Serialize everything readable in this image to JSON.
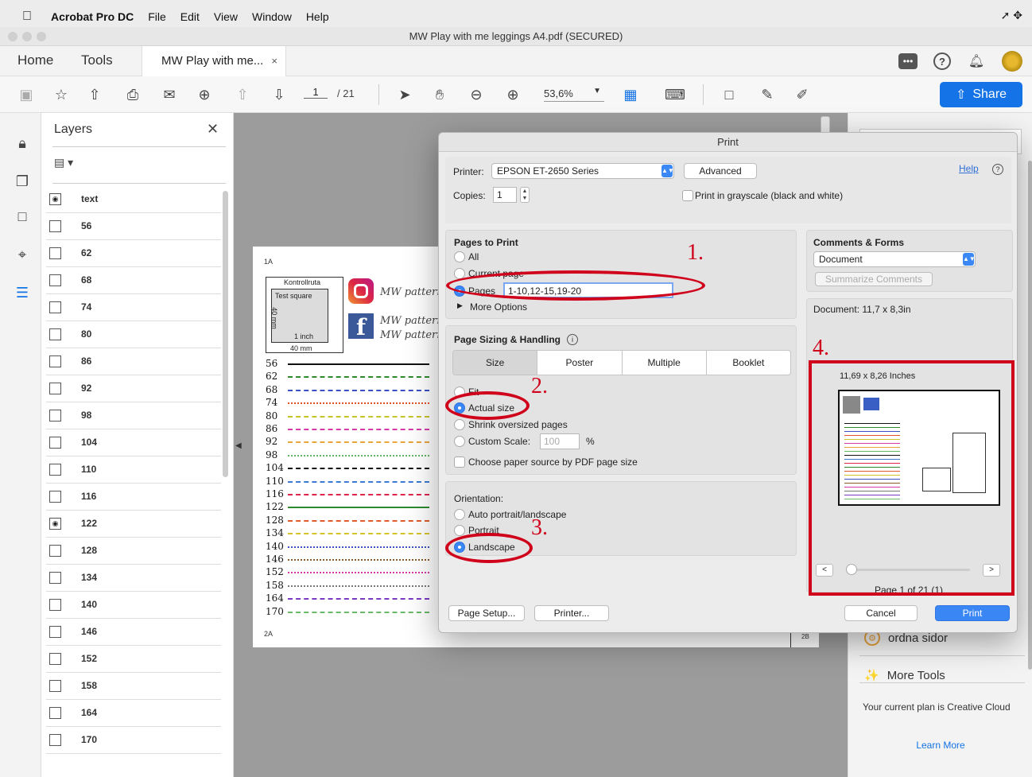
{
  "menubar": {
    "app": "Acrobat Pro DC",
    "items": [
      "File",
      "Edit",
      "View",
      "Window",
      "Help"
    ]
  },
  "window": {
    "title": "MW Play with me leggings A4.pdf (SECURED)"
  },
  "tabs": {
    "home": "Home",
    "tools": "Tools",
    "document": "MW Play with me...",
    "close": "×"
  },
  "toolbar": {
    "page_current": "1",
    "page_total": "/ 21",
    "zoom": "53,6%",
    "share": "Share"
  },
  "layers_panel": {
    "title": "Layers",
    "items": [
      {
        "name": "text",
        "visible": true
      },
      {
        "name": "56",
        "visible": false
      },
      {
        "name": "62",
        "visible": false
      },
      {
        "name": "68",
        "visible": false
      },
      {
        "name": "74",
        "visible": false
      },
      {
        "name": "80",
        "visible": false
      },
      {
        "name": "86",
        "visible": false
      },
      {
        "name": "92",
        "visible": false
      },
      {
        "name": "98",
        "visible": false
      },
      {
        "name": "104",
        "visible": false
      },
      {
        "name": "110",
        "visible": false
      },
      {
        "name": "116",
        "visible": false
      },
      {
        "name": "122",
        "visible": true
      },
      {
        "name": "128",
        "visible": false
      },
      {
        "name": "134",
        "visible": false
      },
      {
        "name": "140",
        "visible": false
      },
      {
        "name": "146",
        "visible": false
      },
      {
        "name": "152",
        "visible": false
      },
      {
        "name": "158",
        "visible": false
      },
      {
        "name": "164",
        "visible": false
      },
      {
        "name": "170",
        "visible": false
      }
    ]
  },
  "document": {
    "page_mark_top": "1A",
    "page_mark_bottom": "2A",
    "page_mark_right": "2B",
    "kontrollruta": "Kontrollruta",
    "test_square": "Test square",
    "one_inch_v": "1 inch",
    "mm_v": "40 mm",
    "one_inch_h": "1 inch",
    "mm_h": "40 mm",
    "brand_1": "MW patterns",
    "brand_2": "MW patterns",
    "brand_3": "MW patterns",
    "size_lines": [
      {
        "size": "56",
        "color": "#111111",
        "style": "solid"
      },
      {
        "size": "62",
        "color": "#2d8a2d",
        "style": "dashed"
      },
      {
        "size": "68",
        "color": "#3b4fc4",
        "style": "dashed"
      },
      {
        "size": "74",
        "color": "#e0532a",
        "style": "dotted"
      },
      {
        "size": "80",
        "color": "#c7c42a",
        "style": "dashed"
      },
      {
        "size": "86",
        "color": "#d63aa8",
        "style": "dashed"
      },
      {
        "size": "92",
        "color": "#e8a53a",
        "style": "dashed"
      },
      {
        "size": "98",
        "color": "#5fb85f",
        "style": "dotted"
      },
      {
        "size": "104",
        "color": "#111111",
        "style": "dashed"
      },
      {
        "size": "110",
        "color": "#3b7bd4",
        "style": "dashed"
      },
      {
        "size": "116",
        "color": "#e0254a",
        "style": "dashed"
      },
      {
        "size": "122",
        "color": "#2d8a2d",
        "style": "solid"
      },
      {
        "size": "128",
        "color": "#e05a2a",
        "style": "dashed"
      },
      {
        "size": "134",
        "color": "#d4c42a",
        "style": "dashed"
      },
      {
        "size": "140",
        "color": "#3b4fc4",
        "style": "dotted"
      },
      {
        "size": "146",
        "color": "#8a5a2a",
        "style": "dotted"
      },
      {
        "size": "152",
        "color": "#d63aa8",
        "style": "dotted"
      },
      {
        "size": "158",
        "color": "#777777",
        "style": "dotted"
      },
      {
        "size": "164",
        "color": "#7a3ac4",
        "style": "dashed"
      },
      {
        "size": "170",
        "color": "#6ab86a",
        "style": "dashed"
      }
    ]
  },
  "right_panel": {
    "organize": "ordna sidor",
    "more_tools": "More Tools",
    "plan": "Your current plan is Creative Cloud",
    "learn_more": "Learn More"
  },
  "print_dialog": {
    "title": "Print",
    "printer_label": "Printer:",
    "printer_value": "EPSON ET-2650 Series",
    "advanced": "Advanced",
    "help": "Help",
    "copies_label": "Copies:",
    "copies_value": "1",
    "grayscale": "Print in grayscale (black and white)",
    "pages_to_print": {
      "heading": "Pages to Print",
      "all": "All",
      "current": "Current page",
      "pages": "Pages",
      "pages_value": "1-10,12-15,19-20",
      "more_options": "More Options"
    },
    "sizing": {
      "heading": "Page Sizing & Handling",
      "tabs": [
        "Size",
        "Poster",
        "Multiple",
        "Booklet"
      ],
      "fit": "Fit",
      "actual": "Actual size",
      "shrink": "Shrink oversized pages",
      "custom": "Custom Scale:",
      "custom_value": "100",
      "percent": "%",
      "paper_source": "Choose paper source by PDF page size"
    },
    "orientation": {
      "heading": "Orientation:",
      "auto": "Auto portrait/landscape",
      "portrait": "Portrait",
      "landscape": "Landscape"
    },
    "comments": {
      "heading": "Comments & Forms",
      "value": "Document",
      "summarize": "Summarize Comments"
    },
    "document_size": "Document: 11,7 x 8,3in",
    "preview_size": "11,69 x 8,26 Inches",
    "page_of": "Page 1 of 21 (1)",
    "page_setup": "Page Setup...",
    "printer_btn": "Printer...",
    "cancel": "Cancel",
    "print": "Print"
  },
  "annotations": {
    "one": "1.",
    "two": "2.",
    "three": "3.",
    "four": "4."
  },
  "colors": {
    "accent": "#1473e6",
    "annotation": "#d0021b",
    "dialog_primary": "#3a86f5"
  }
}
